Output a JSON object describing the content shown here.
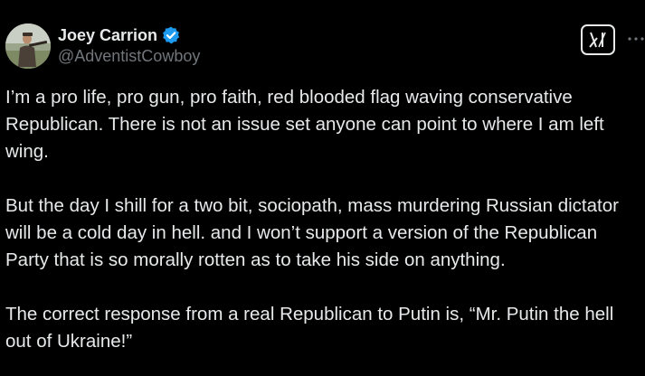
{
  "author": {
    "display_name": "Joey Carrion",
    "handle": "@AdventistCowboy",
    "verified": true
  },
  "icons": {
    "avatar": "avatar",
    "verified": "verified-badge-icon",
    "grok": "grok-icon",
    "more": "more-options-icon"
  },
  "colors": {
    "background": "#000000",
    "text": "#e7e9ea",
    "secondary_text": "#71767b",
    "verified_blue": "#1d9bf0"
  },
  "post": {
    "paragraphs": [
      "I’m a pro life, pro gun, pro faith, red blooded flag waving conservative Republican. There is not an issue set anyone can point to where I am left wing.",
      "But the day I shill for a two bit, sociopath, mass murdering Russian dictator will be a cold day in hell. and I won’t support a version of the Republican Party that is so morally rotten as to take his side on anything.",
      "The correct response from a real Republican to Putin is, “Mr. Putin the hell out of Ukraine!”"
    ]
  }
}
